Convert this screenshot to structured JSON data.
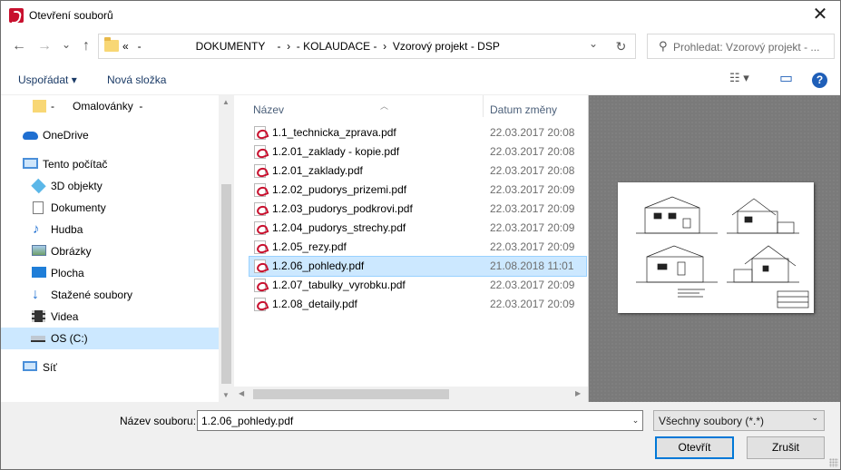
{
  "window": {
    "title": "Otevření souborů",
    "close_glyph": "✕"
  },
  "nav": {
    "back_glyph": "←",
    "forward_glyph": "→",
    "recent_glyph": "⌄",
    "up_glyph": "↑",
    "address_path": "«   -                  DOKUMENTY    -  ›  - KOLAUDACE -  ›  Vzorový projekt - DSP",
    "address_dropdown_glyph": "⌄",
    "refresh_glyph": "↻",
    "search_placeholder": "Prohledat: Vzorový projekt - ..."
  },
  "toolbar": {
    "organize_label": "Uspořádat ▾",
    "new_folder_label": "Nová složka",
    "view_glyph": "☷ ▾",
    "pane_glyph": "▭",
    "help_glyph": "?"
  },
  "sidebar": {
    "items": [
      {
        "label": "-      Omalovánky  -",
        "icon": "folder-icon"
      },
      {
        "label": "OneDrive",
        "icon": "cloud-icon"
      },
      {
        "label": "Tento počítač",
        "icon": "computer-icon"
      },
      {
        "label": "3D objekty",
        "icon": "cube-icon"
      },
      {
        "label": "Dokumenty",
        "icon": "document-icon"
      },
      {
        "label": "Hudba",
        "icon": "music-icon"
      },
      {
        "label": "Obrázky",
        "icon": "picture-icon"
      },
      {
        "label": "Plocha",
        "icon": "desktop-icon"
      },
      {
        "label": "Stažené soubory",
        "icon": "download-icon"
      },
      {
        "label": "Videa",
        "icon": "video-icon"
      },
      {
        "label": "OS (C:)",
        "icon": "drive-icon"
      },
      {
        "label": "Síť",
        "icon": "network-icon"
      }
    ]
  },
  "files": {
    "col_name": "Název",
    "col_date": "Datum změny",
    "rows": [
      {
        "name": "1.1_technicka_zprava.pdf",
        "date": "22.03.2017 20:08"
      },
      {
        "name": "1.2.01_zaklady - kopie.pdf",
        "date": "22.03.2017 20:08"
      },
      {
        "name": "1.2.01_zaklady.pdf",
        "date": "22.03.2017 20:08"
      },
      {
        "name": "1.2.02_pudorys_prizemi.pdf",
        "date": "22.03.2017 20:09"
      },
      {
        "name": "1.2.03_pudorys_podkrovi.pdf",
        "date": "22.03.2017 20:09"
      },
      {
        "name": "1.2.04_pudorys_strechy.pdf",
        "date": "22.03.2017 20:09"
      },
      {
        "name": "1.2.05_rezy.pdf",
        "date": "22.03.2017 20:09"
      },
      {
        "name": "1.2.06_pohledy.pdf",
        "date": "21.08.2018 11:01"
      },
      {
        "name": "1.2.07_tabulky_vyrobku.pdf",
        "date": "22.03.2017 20:09"
      },
      {
        "name": "1.2.08_detaily.pdf",
        "date": "22.03.2017 20:09"
      }
    ],
    "selected_index": 7
  },
  "footer": {
    "filename_label": "Název souboru:",
    "filename_value": "1.2.06_pohledy.pdf",
    "filetype_value": "Všechny soubory (*.*)",
    "open_label": "Otevřít",
    "cancel_label": "Zrušit"
  },
  "colors": {
    "selection": "#cce8ff",
    "accent": "#0078d7",
    "pdf_red": "#c8102e"
  }
}
